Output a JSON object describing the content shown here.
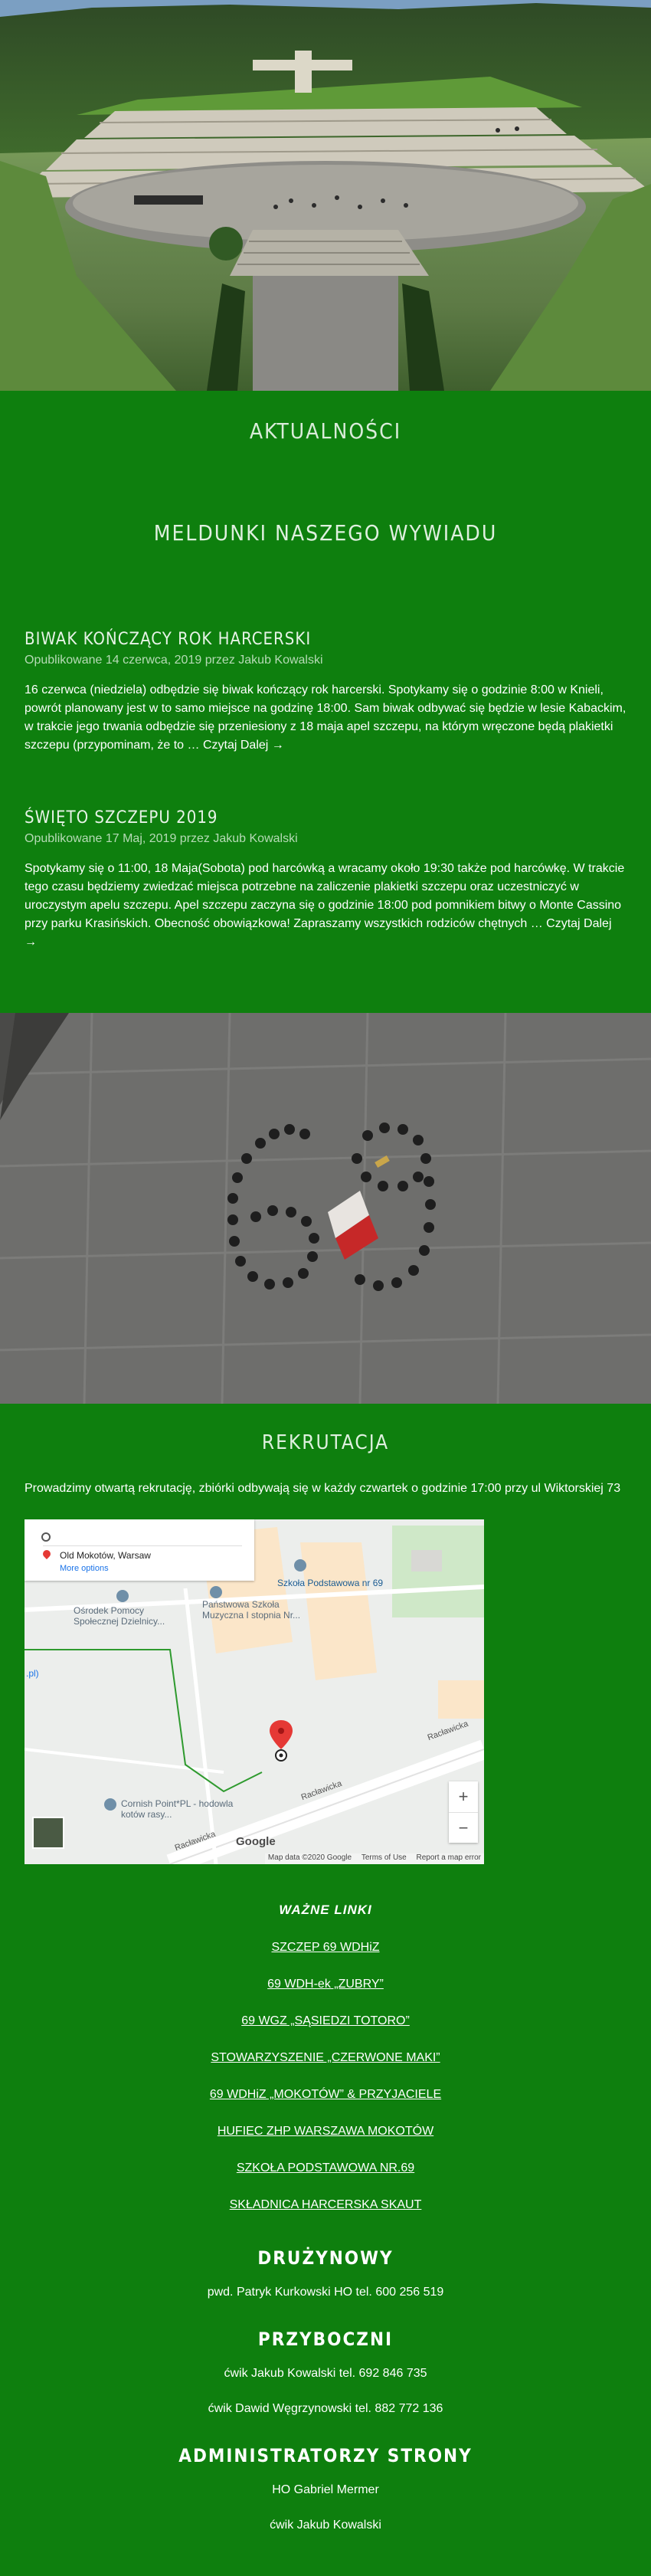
{
  "news": {
    "heading": "AKTUALNOŚCI",
    "intel_heading": "MELDUNKI NASZEGO WYWIADU",
    "posts": [
      {
        "title": "BIWAK KOŃCZĄCY ROK HARCERSKI",
        "meta": "Opublikowane 14 czerwca, 2019 przez Jakub Kowalski",
        "excerpt": "16 czerwca (niedziela) odbędzie się biwak kończący rok harcerski. Spotykamy się o godzinie 8:00 w Knieli, powrót planowany jest w to samo miejsce na godzinę 18:00. Sam biwak odbywać się będzie w lesie Kabackim, w trakcie jego trwania odbędzie się przeniesiony z 18 maja apel szczepu, na którym wręczone będą plakietki szczepu (przypominam, że to … ",
        "read_more": "Czytaj Dalej →"
      },
      {
        "title": "ŚWIĘTO SZCZEPU 2019",
        "meta": "Opublikowane 17 Maj, 2019 przez Jakub Kowalski",
        "excerpt": "Spotykamy się o 11:00, 18 Maja(Sobota) pod harcówką a wracamy około 19:30 także pod harcówkę. W trakcie tego czasu będziemy zwiedzać miejsca potrzebne na zaliczenie plakietki szczepu oraz uczestniczyć w uroczystym apelu szczepu. Apel szczepu zaczyna się o godzinie 18:00 pod pomnikiem bitwy o Monte Cassino przy parku Krasińskich. Obecność obowiązkowa! Zapraszamy wszystkich rodziców chętnych … ",
        "read_more": "Czytaj Dalej →"
      }
    ]
  },
  "recruitment": {
    "heading": "REKRUTACJA",
    "text": "Prowadzimy otwartą rekrutację, zbiórki odbywają się w każdy czwartek o godzinie 17:00  przy ul Wiktorskiej 73"
  },
  "map": {
    "directions_from": "",
    "directions_to": "Old Mokotów, Warsaw",
    "more_options": "More options",
    "labels": {
      "school69": "Szkoła Podstawowa nr 69",
      "music_school": "Państwowa Szkoła Muzyczna I stopnia Nr...",
      "help_center": "Ośrodek Pomocy Społecznej Dzielnicy...",
      "cornish": "Cornish Point*PL - hodowla kotów rasy...",
      "racl1": "Racławicka",
      "racl2": "Racławicka",
      "racl3": "Racławicka",
      "edge": ".pl)"
    },
    "zoom_in": "+",
    "zoom_out": "−",
    "google": "Google",
    "footer": {
      "data": "Map data ©2020 Google",
      "terms": "Terms of Use",
      "report": "Report a map error"
    },
    "colors": {
      "marker": "#e53935",
      "road": "#ffffff",
      "park": "#cde8c6",
      "building": "#fbe3c3",
      "route": "#2e9a2e",
      "pin": "#6f8fa8"
    }
  },
  "links": {
    "title": "WAŻNE LINKI",
    "items": [
      "SZCZEP 69 WDHiZ",
      "69 WDH-ek „ZUBRY”",
      "69 WGZ „SĄSIEDZI TOTORO”",
      "STOWARZYSZENIE „CZERWONE MAKI”",
      "69 WDHiZ „MOKOTÓW” & PRZYJACIELE",
      "HUFIEC ZHP WARSZAWA MOKOTÓW",
      "SZKOŁA PODSTAWOWA NR.69",
      "SKŁADNICA HARCERSKA SKAUT"
    ]
  },
  "contacts": {
    "leader_heading": "DRUŻYNOWY",
    "leader": "pwd. Patryk Kurkowski HO tel. 600 256 519",
    "deputies_heading": "PRZYBOCZNI",
    "deputies": [
      "ćwik Jakub Kowalski tel. 692 846 735",
      "ćwik Dawid Węgrzynowski tel. 882 772 136"
    ],
    "admins_heading": "ADMINISTRATORZY STRONY",
    "admins": [
      "HO Gabriel Mermer",
      "ćwik Jakub Kowalski"
    ]
  },
  "theme": {
    "background": "#0e7f0e"
  }
}
